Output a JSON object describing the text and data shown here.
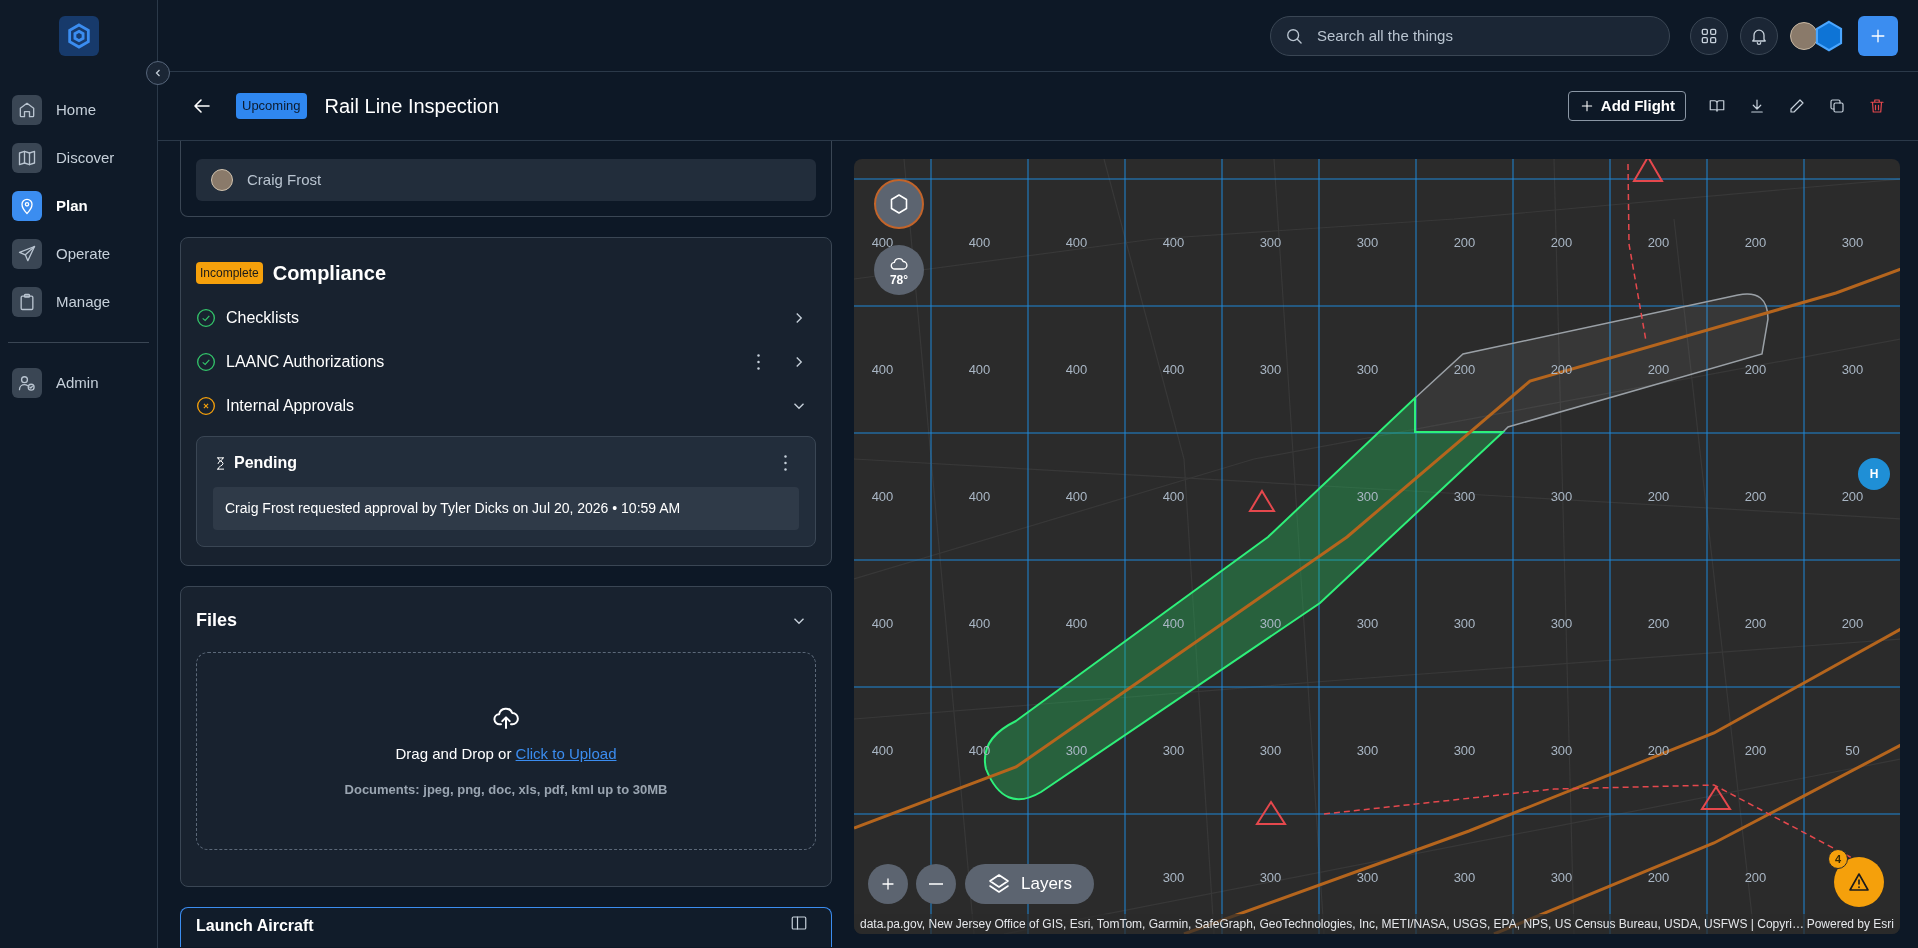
{
  "sidebar": {
    "main_items": [
      {
        "label": "Home",
        "selected": false
      },
      {
        "label": "Discover",
        "selected": false
      },
      {
        "label": "Plan",
        "selected": true
      },
      {
        "label": "Operate",
        "selected": false
      },
      {
        "label": "Manage",
        "selected": false
      }
    ],
    "secondary_items": [
      {
        "label": "Admin",
        "selected": false
      }
    ]
  },
  "top_bar": {
    "search": {
      "placeholder": "Search all the things"
    }
  },
  "header": {
    "status_badge": "Upcoming",
    "title": "Rail Line Inspection",
    "add_flight_label": "Add Flight"
  },
  "assignee": {
    "name": "Craig Frost"
  },
  "compliance": {
    "badge": "Incomplete",
    "title": "Compliance",
    "items": [
      {
        "label": "Checklists",
        "complete": true,
        "has_menu": false,
        "expanded": false
      },
      {
        "label": "LAANC Authorizations",
        "complete": true,
        "has_menu": true,
        "expanded": false
      },
      {
        "label": "Internal Approvals",
        "complete": false,
        "has_menu": false,
        "expanded": true
      }
    ],
    "approval": {
      "title": "Pending",
      "message": "Craig Frost requested approval by Tyler Dicks on Jul 20, 2026 • 10:59 AM"
    }
  },
  "files": {
    "title": "Files",
    "expanded": true,
    "drop_text": "Drag and Drop or",
    "upload_link": "Click to Upload",
    "hint": "Documents: jpeg, png, doc, xls, pdf, kml up to 30MB"
  },
  "launch": {
    "title": "Launch Aircraft"
  },
  "map": {
    "weather": "78°",
    "grid_rows": [
      [
        "400",
        "400",
        "400",
        "400",
        "300",
        "300",
        "200",
        "200",
        "200",
        "200",
        "300"
      ],
      [
        "400",
        "400",
        "400",
        "400",
        "300",
        "300",
        "200",
        "200",
        "200",
        "200",
        "300"
      ],
      [
        "400",
        "400",
        "400",
        "400",
        null,
        "300",
        "300",
        "300",
        "200",
        "200",
        "200"
      ],
      [
        "400",
        "400",
        "400",
        "400",
        "300",
        "300",
        "300",
        "300",
        "200",
        "200",
        "200"
      ],
      [
        "400",
        "400",
        "300",
        "300",
        "300",
        "300",
        "300",
        "300",
        "200",
        "200",
        "50"
      ],
      [
        null,
        null,
        null,
        "300",
        "300",
        "300",
        "300",
        "300",
        "200",
        "200",
        null
      ]
    ],
    "heliport_label": "H",
    "layers_label": "Layers",
    "alert_count": "4",
    "attribution": "data.pa.gov, New Jersey Office of GIS, Esri, TomTom, Garmin, SafeGraph, GeoTechnologies, Inc, METI/NASA, USGS, EPA, NPS, US Census Bureau, USDA, USFWS | Copyri…",
    "powered_by": "Powered by Esri"
  }
}
